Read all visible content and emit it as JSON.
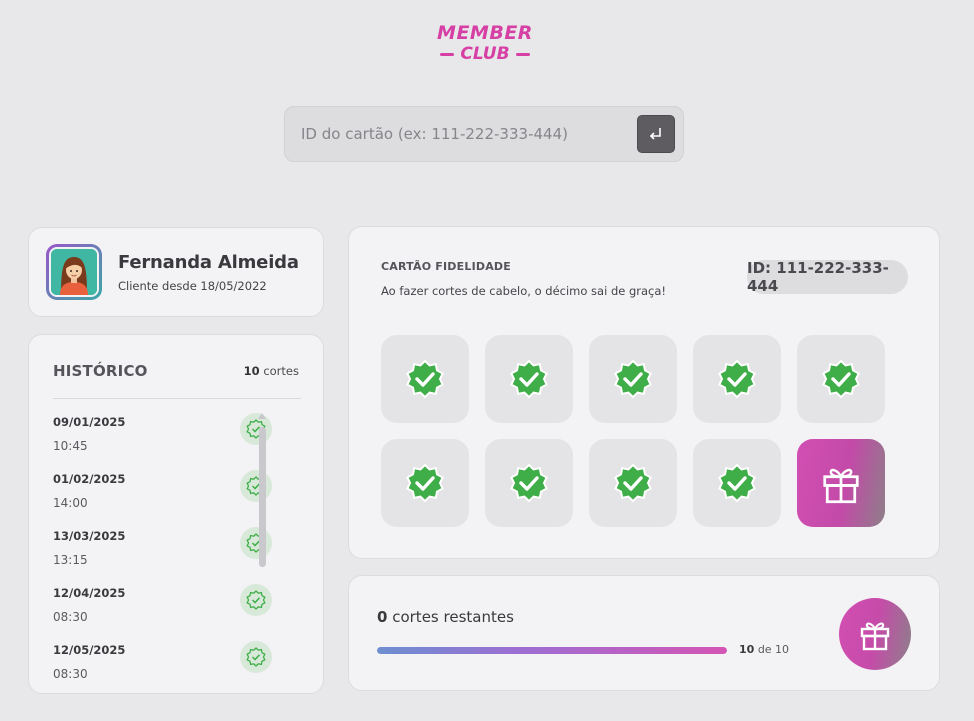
{
  "logo": {
    "line1": "MEMBER",
    "line2": "CLUB"
  },
  "search": {
    "placeholder": "ID do cartão (ex: 111-222-333-444)",
    "value": "",
    "submit_icon": "enter-icon"
  },
  "profile": {
    "name": "Fernanda Almeida",
    "since": "Cliente desde 18/05/2022",
    "avatar_icon": "woman-avatar-icon"
  },
  "history": {
    "title": "HISTÓRICO",
    "count_value": "10",
    "count_unit": "cortes",
    "items": [
      {
        "date": "09/01/2025",
        "time": "10:45"
      },
      {
        "date": "01/02/2025",
        "time": "14:00"
      },
      {
        "date": "13/03/2025",
        "time": "13:15"
      },
      {
        "date": "12/04/2025",
        "time": "08:30"
      },
      {
        "date": "12/05/2025",
        "time": "08:30"
      }
    ]
  },
  "loyalty": {
    "label": "CARTÃO FIDELIDADE",
    "description": "Ao fazer cortes de cabelo, o décimo sai de graça!",
    "card_id": "ID: 111-222-333-444",
    "stamps_total": 10,
    "stamps_done": 9
  },
  "progress": {
    "remaining_value": "0",
    "remaining_label": "cortes restantes",
    "done": "10",
    "of_total": "de 10",
    "fraction": 1.0
  },
  "colors": {
    "accent": "#d24fb3",
    "check": "#3fae49",
    "background": "#e8e7ea"
  }
}
